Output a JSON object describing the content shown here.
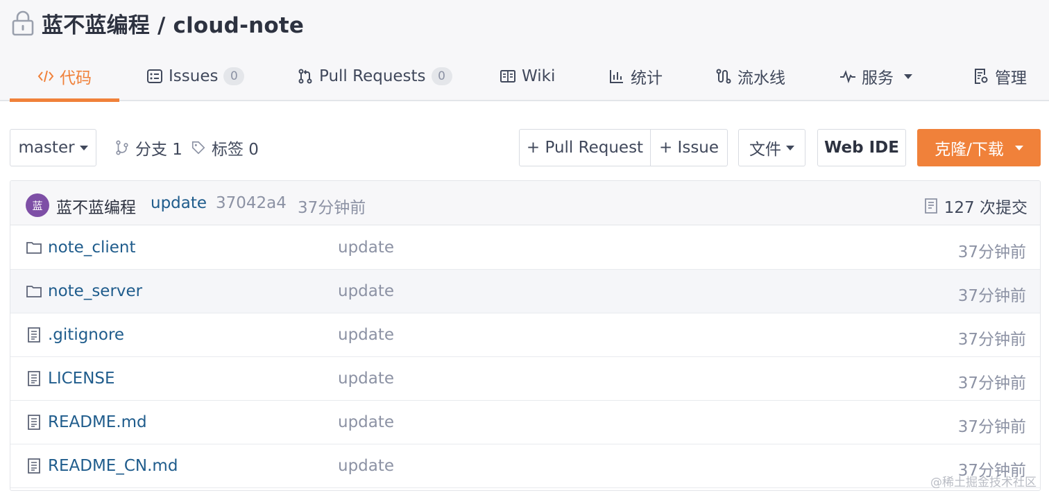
{
  "repo": {
    "name": "蓝不蓝编程 / cloud-note",
    "lock_icon": "lock-icon"
  },
  "tabs": [
    {
      "label": "代码",
      "icon": "code-icon",
      "active": true
    },
    {
      "label": "Issues",
      "icon": "issues-icon",
      "count": "0"
    },
    {
      "label": "Pull Requests",
      "icon": "pull-request-icon",
      "count": "0"
    },
    {
      "label": "Wiki",
      "icon": "book-icon"
    },
    {
      "label": "统计",
      "icon": "bar-chart-icon"
    },
    {
      "label": "流水线",
      "icon": "pipeline-icon"
    },
    {
      "label": "服务",
      "icon": "pulse-icon",
      "dropdown": true
    },
    {
      "label": "管理",
      "icon": "settings-doc-icon"
    }
  ],
  "toolbar": {
    "branch": "master",
    "branches_label": "分支 1",
    "tags_label": "标签 0",
    "pull_request_button": "+ Pull Request",
    "issue_button": "+ Issue",
    "file_button": "文件",
    "web_ide_button": "Web IDE",
    "clone_button": "克隆/下载"
  },
  "commit": {
    "avatar_text": "蓝",
    "author": "蓝不蓝编程",
    "message": "update",
    "sha": "37042a4",
    "time": "37分钟前",
    "count": "127 次提交"
  },
  "files": [
    {
      "name": "note_client",
      "type": "folder",
      "message": "update",
      "time": "37分钟前"
    },
    {
      "name": "note_server",
      "type": "folder",
      "message": "update",
      "time": "37分钟前"
    },
    {
      "name": ".gitignore",
      "type": "file",
      "message": "update",
      "time": "37分钟前"
    },
    {
      "name": "LICENSE",
      "type": "file",
      "message": "update",
      "time": "37分钟前"
    },
    {
      "name": "README.md",
      "type": "file",
      "message": "update",
      "time": "37分钟前"
    },
    {
      "name": "README_CN.md",
      "type": "file",
      "message": "update",
      "time": "37分钟前"
    }
  ],
  "watermark": "@稀土掘金技术社区",
  "colors": {
    "accent": "#f0813a",
    "link": "#1f5c8c",
    "muted": "#8c92a4",
    "avatar": "#7e4fa6"
  }
}
